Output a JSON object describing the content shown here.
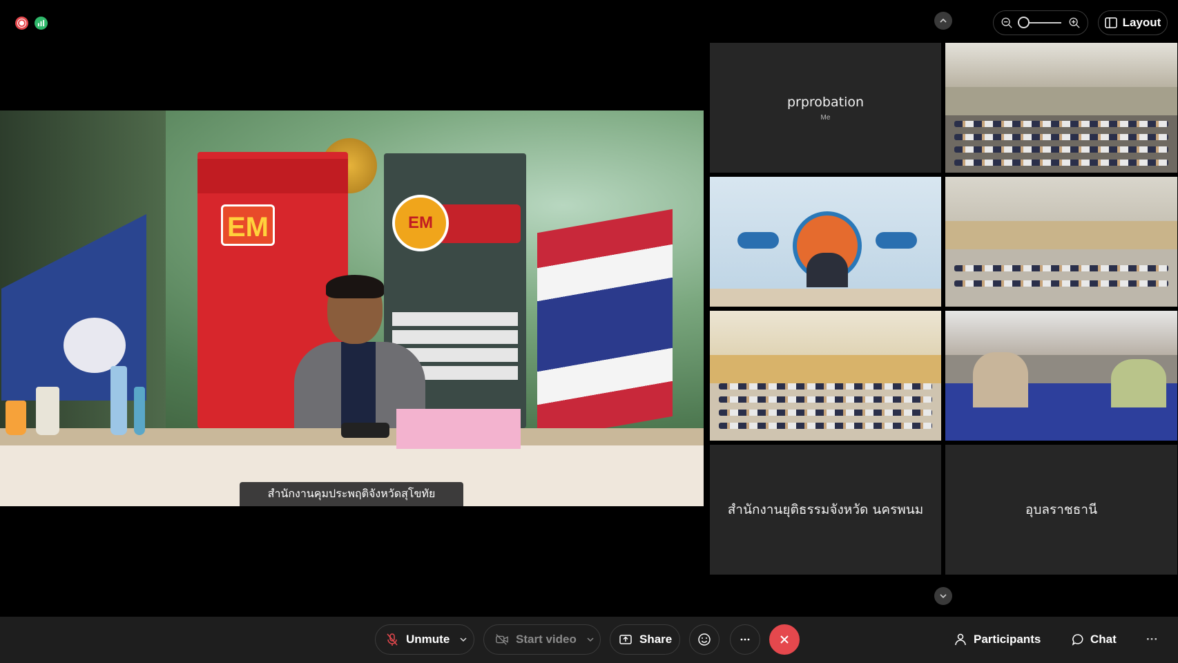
{
  "app": {
    "status_icons": [
      "recording-icon",
      "stats-icon"
    ],
    "accent_red": "#e5484d",
    "accent_green": "#2fb86a"
  },
  "topbar": {
    "layout_label": "Layout",
    "zoom_out_icon": "zoom-out-icon",
    "zoom_in_icon": "zoom-in-icon"
  },
  "main_video": {
    "caption": "สำนักงานคุมประพฤติจังหวัดสุโขทัย"
  },
  "grid": {
    "tiles": [
      {
        "name": "prprobation",
        "sub": "Me",
        "video": false
      },
      {
        "name": "",
        "video": true
      },
      {
        "name": "",
        "video": true
      },
      {
        "name": "",
        "video": true
      },
      {
        "name": "",
        "video": true
      },
      {
        "name": "",
        "video": true
      },
      {
        "name": "สำนักงานยุติธรรมจังหวัด นครพนม",
        "video": false
      },
      {
        "name": "อุบลราชธานี",
        "video": false
      }
    ]
  },
  "toolbar": {
    "unmute_label": "Unmute",
    "start_video_label": "Start video",
    "share_label": "Share",
    "participants_label": "Participants",
    "chat_label": "Chat",
    "more_label": "···"
  }
}
